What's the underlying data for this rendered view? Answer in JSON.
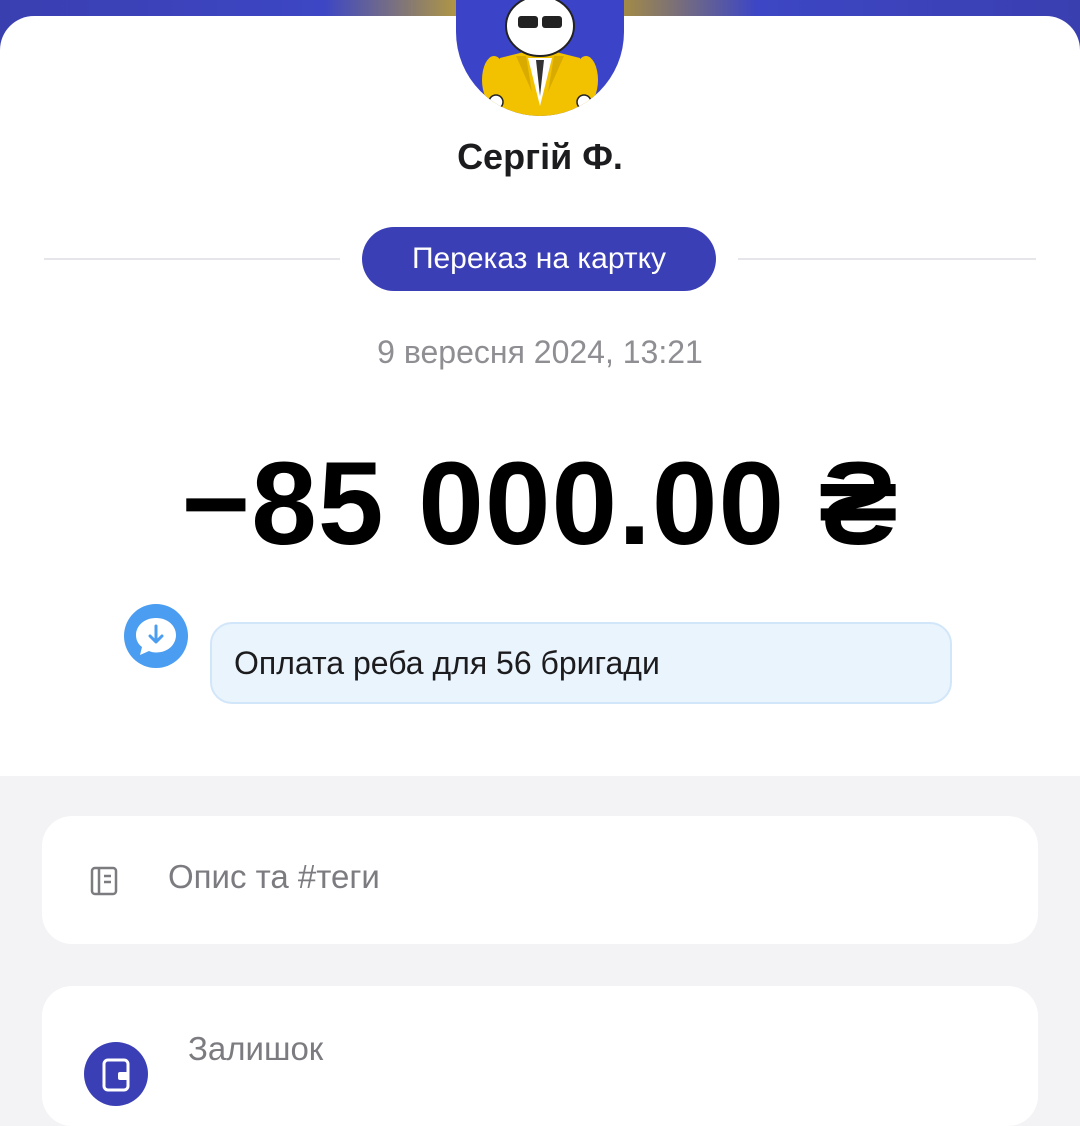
{
  "recipient": {
    "name": "Сергій Ф."
  },
  "transaction": {
    "type_label": "Переказ на картку",
    "datetime": "9 вересня 2024, 13:21",
    "amount": "−85 000.00 ₴",
    "comment": "Оплата реба для 56 бригади"
  },
  "details": {
    "description_label": "Опис та #теги",
    "balance_label": "Залишок"
  },
  "icons": {
    "avatar": "cartoon-avatar",
    "comment": "comment-download-icon",
    "description": "note-icon",
    "balance": "wallet-icon"
  },
  "colors": {
    "accent": "#3b3fb5",
    "comment_icon": "#4a9df0",
    "comment_bg": "#eaf4fd"
  }
}
